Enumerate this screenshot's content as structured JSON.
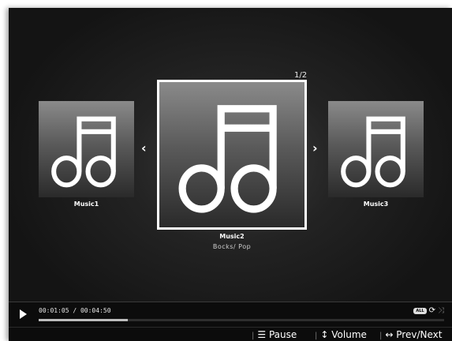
{
  "counter": "1/2",
  "albums": [
    {
      "title": "Music1",
      "genre": ""
    },
    {
      "title": "Music2",
      "genre": "Bocks/ Pop"
    },
    {
      "title": "Music3",
      "genre": ""
    }
  ],
  "player": {
    "time": "00:01:05 / 00:04:50",
    "progress_fraction": 0.22,
    "repeat_badge": "ALL"
  },
  "hints": [
    {
      "icon": "☰",
      "label": "Pause"
    },
    {
      "icon": "↕",
      "label": "Volume"
    },
    {
      "icon": "↔",
      "label": "Prev/Next"
    }
  ],
  "icons": {
    "left_arrow": "‹",
    "right_arrow": "›"
  }
}
